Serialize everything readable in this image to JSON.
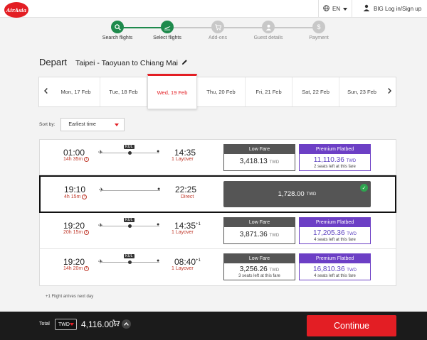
{
  "header": {
    "logo_text": "AirAsia",
    "language": "EN",
    "login_label": "BIG Log in/Sign up"
  },
  "steps": [
    {
      "label": "Search flights",
      "icon": "search-icon",
      "state": "done"
    },
    {
      "label": "Select flights",
      "icon": "plane-takeoff-icon",
      "state": "current"
    },
    {
      "label": "Add-ons",
      "icon": "cart-icon",
      "state": "pending"
    },
    {
      "label": "Guest details",
      "icon": "user-icon",
      "state": "pending"
    },
    {
      "label": "Payment",
      "icon": "dollar-icon",
      "state": "pending"
    }
  ],
  "depart": {
    "title": "Depart",
    "route": "Taipei - Taoyuan to Chiang Mai"
  },
  "dates": [
    {
      "label": "Mon, 17 Feb"
    },
    {
      "label": "Tue, 18 Feb"
    },
    {
      "label": "Wed, 19 Feb",
      "selected": true
    },
    {
      "label": "Thu, 20 Feb"
    },
    {
      "label": "Fri, 21 Feb"
    },
    {
      "label": "Sat, 22 Feb"
    },
    {
      "label": "Sun, 23 Feb"
    }
  ],
  "sort": {
    "label": "Sort by:",
    "value": "Earliest time"
  },
  "flights": [
    {
      "depart": "01:00",
      "duration": "14h 35m",
      "stop": "KUL",
      "arrive": "14:35",
      "arrive_suffix": "",
      "stops_label": "1 Layover",
      "low_fare": {
        "header": "Low Fare",
        "price": "3,418.13",
        "currency": "TWD",
        "seats": ""
      },
      "premium": {
        "header": "Premium Flatbed",
        "price": "11,110.36",
        "currency": "TWD",
        "seats": "2 seats left at this fare"
      }
    },
    {
      "depart": "19:10",
      "duration": "4h 15m",
      "stop": "",
      "arrive": "22:25",
      "arrive_suffix": "",
      "stops_label": "Direct",
      "selected_fare": {
        "price": "1,728.00",
        "currency": "TWD"
      }
    },
    {
      "depart": "19:20",
      "duration": "20h 15m",
      "stop": "KUL",
      "arrive": "14:35",
      "arrive_suffix": "+1",
      "stops_label": "1 Layover",
      "low_fare": {
        "header": "Low Fare",
        "price": "3,871.36",
        "currency": "TWD",
        "seats": ""
      },
      "premium": {
        "header": "Premium Flatbed",
        "price": "17,205.36",
        "currency": "TWD",
        "seats": "4 seats left at this fare"
      }
    },
    {
      "depart": "19:20",
      "duration": "14h 20m",
      "stop": "KUL",
      "arrive": "08:40",
      "arrive_suffix": "+1",
      "stops_label": "1 Layover",
      "low_fare": {
        "header": "Low Fare",
        "price": "3,256.26",
        "currency": "TWD",
        "seats": "3 seats left at this fare"
      },
      "premium": {
        "header": "Premium Flatbed",
        "price": "16,810.36",
        "currency": "TWD",
        "seats": "4 seats left at this fare"
      }
    }
  ],
  "footnote": "+1 Flight arrives next day",
  "footer": {
    "total_label": "Total",
    "currency": "TWD",
    "total_amount": "4,116.00",
    "continue_label": "Continue"
  },
  "colors": {
    "brand_red": "#e31e24",
    "step_active": "#1e8a4c",
    "premium_purple": "#6c3fc5",
    "layover_red": "#c0392b"
  }
}
